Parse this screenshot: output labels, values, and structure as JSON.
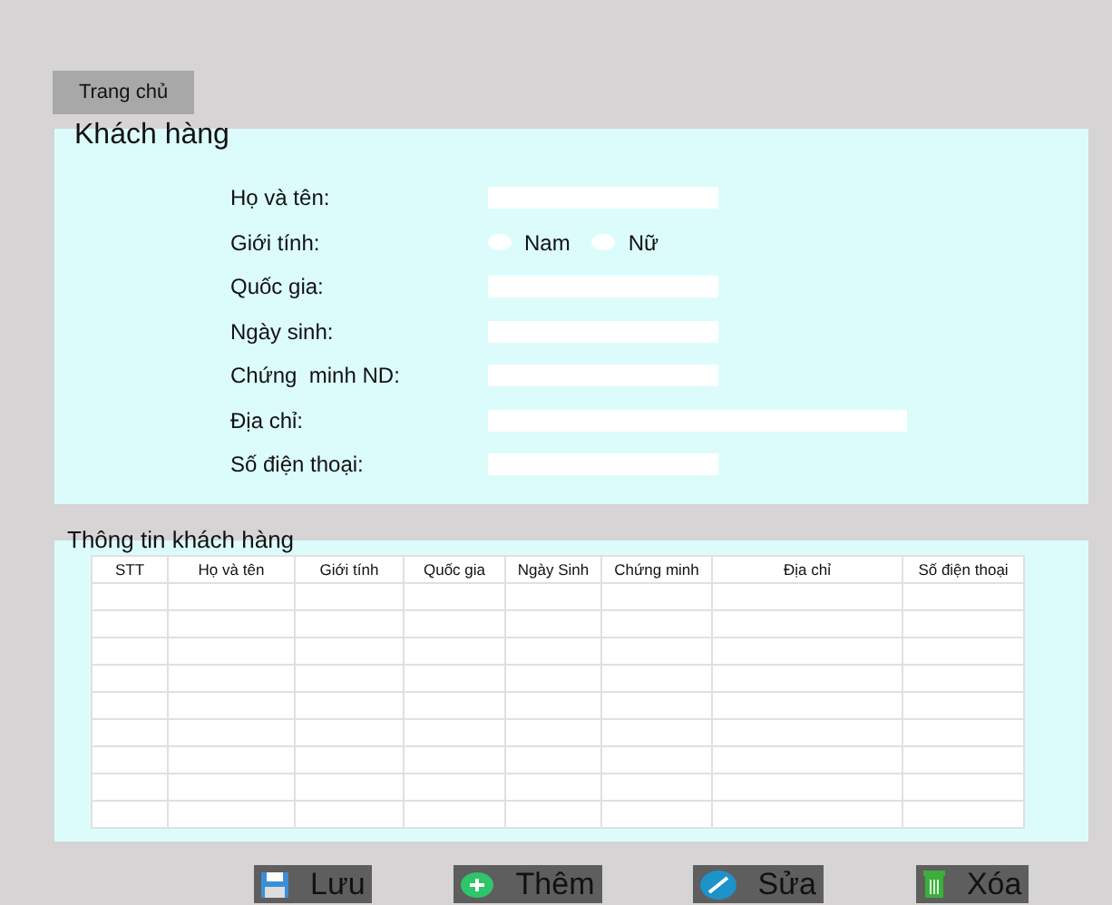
{
  "nav_button": "Trang chủ",
  "customer_form": {
    "title": "Khách hàng",
    "fields": [
      {
        "kind": "text",
        "label": "Họ và tên:",
        "wide": false
      },
      {
        "kind": "radio",
        "label": "Giới tính:",
        "options": [
          {
            "label": "Nam",
            "selected": false
          },
          {
            "label": "Nữ",
            "selected": false
          }
        ]
      },
      {
        "kind": "text",
        "label": "Quốc gia:",
        "wide": false
      },
      {
        "kind": "text",
        "label": "Ngày sinh:",
        "wide": false
      },
      {
        "kind": "text",
        "label": "Chứng  minh ND:",
        "wide": false
      },
      {
        "kind": "text",
        "label": "Địa chỉ:",
        "wide": true
      },
      {
        "kind": "text",
        "label": "Số điện thoại:",
        "wide": false
      }
    ]
  },
  "customer_table": {
    "title": "Thông tin khách hàng",
    "columns": [
      "STT",
      "Họ và tên",
      "Giới tính",
      "Quốc gia",
      "Ngày Sinh",
      "Chứng minh",
      "Địa chỉ",
      "Số điện thoại"
    ]
  },
  "buttons": [
    {
      "kind": "save",
      "label": "Lưu"
    },
    {
      "kind": "add",
      "label": "Thêm"
    },
    {
      "kind": "edit",
      "label": "Sửa"
    },
    {
      "kind": "delete",
      "label": "Xóa"
    }
  ]
}
